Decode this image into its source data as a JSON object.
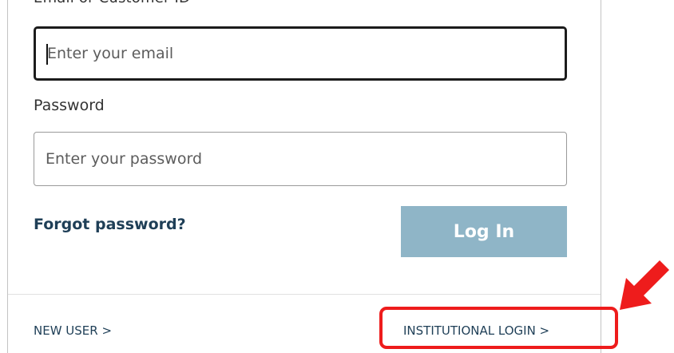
{
  "form": {
    "email_label": "Email or Customer ID",
    "email_placeholder": "Enter your email",
    "password_label": "Password",
    "password_placeholder": "Enter your password",
    "forgot_link": "Forgot password?",
    "login_button": "Log In"
  },
  "footer": {
    "new_user_link": "NEW USER >",
    "institutional_link": "INSTITUTIONAL LOGIN >"
  },
  "colors": {
    "login_button_bg": "#8fb5c7",
    "link_text": "#1f3f57",
    "annotation_red": "#ee1c1c"
  },
  "icons": {
    "annotation_arrow": "red-arrow-icon"
  }
}
